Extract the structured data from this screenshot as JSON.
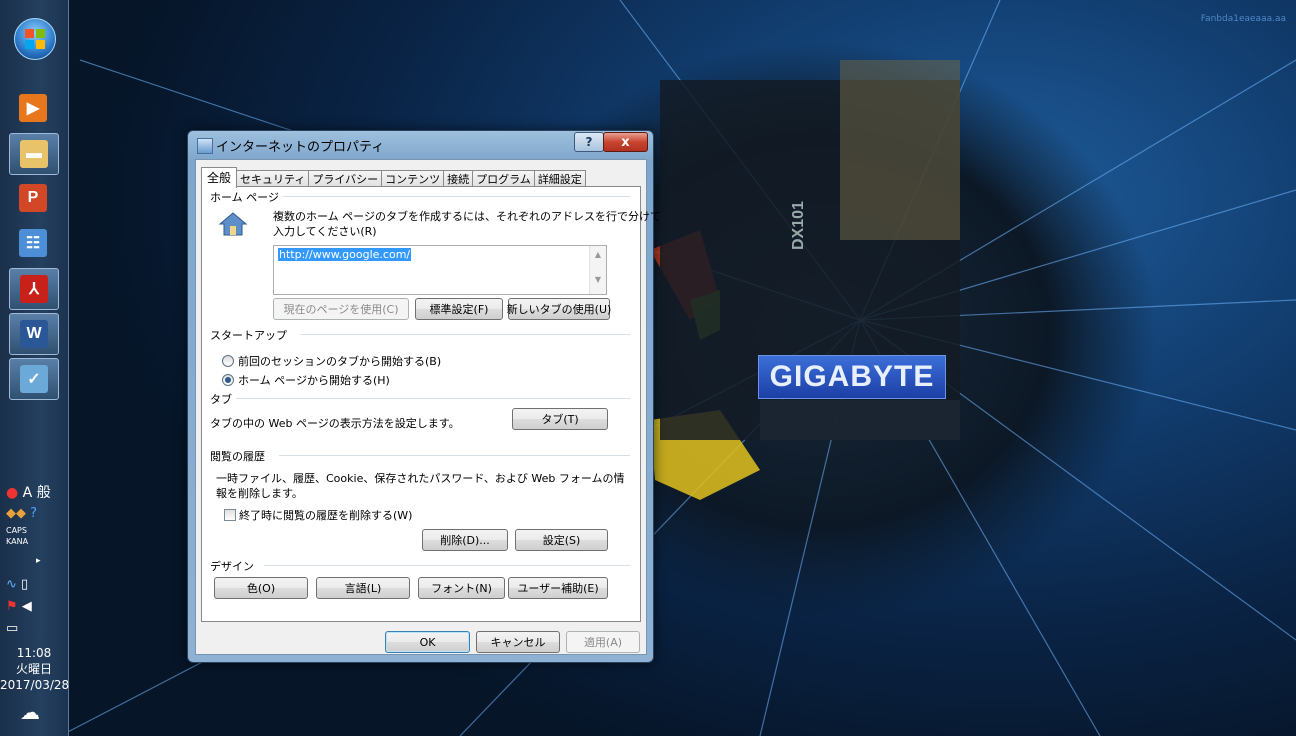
{
  "desktop": {
    "watermark": "Fanbda1eaeaaa.aa",
    "board_brand": "GIGABYTE",
    "board_model": "DX101"
  },
  "taskbar": {
    "tray": {
      "ime_mode": "A 般",
      "caps": "CAPS",
      "kana": "KANA"
    },
    "clock": {
      "time": "11:08",
      "weekday": "火曜日",
      "date": "2017/03/28"
    }
  },
  "dialog": {
    "title": "インターネットのプロパティ",
    "help_label": "?",
    "close_label": "x",
    "tabs": [
      {
        "label": "全般"
      },
      {
        "label": "セキュリティ"
      },
      {
        "label": "プライバシー"
      },
      {
        "label": "コンテンツ"
      },
      {
        "label": "接続"
      },
      {
        "label": "プログラム"
      },
      {
        "label": "詳細設定"
      }
    ],
    "home_page": {
      "heading": "ホーム ページ",
      "description_line1": "複数のホーム ページのタブを作成するには、それぞれのアドレスを行で分けて",
      "description_line2": "入力してください(R)",
      "url": "http://www.google.com/",
      "btn_current": "現在のページを使用(C)",
      "btn_default": "標準設定(F)",
      "btn_new_tab": "新しいタブの使用(U)"
    },
    "startup": {
      "heading": "スタートアップ",
      "option_tabs": "前回のセッションのタブから開始する(B)",
      "option_home": "ホーム ページから開始する(H)",
      "selected": "home"
    },
    "tabs_section": {
      "heading": "タブ",
      "description": "タブの中の Web ページの表示方法を設定します。",
      "btn_tabs": "タブ(T)"
    },
    "history": {
      "heading": "閲覧の履歴",
      "description_line1": "一時ファイル、履歴、Cookie、保存されたパスワード、および Web フォームの情",
      "description_line2": "報を削除します。",
      "checkbox_label": "終了時に閲覧の履歴を削除する(W)",
      "checked": false,
      "btn_delete": "削除(D)...",
      "btn_settings": "設定(S)"
    },
    "design": {
      "heading": "デザイン",
      "btn_colors": "色(O)",
      "btn_languages": "言語(L)",
      "btn_fonts": "フォント(N)",
      "btn_accessibility": "ユーザー補助(E)"
    },
    "footer": {
      "ok": "OK",
      "cancel": "キャンセル",
      "apply": "適用(A)"
    }
  },
  "colors": {
    "accent": "#3399ff",
    "close_red": "#c8452f",
    "titlebar_blue": "#8eb1d4"
  }
}
